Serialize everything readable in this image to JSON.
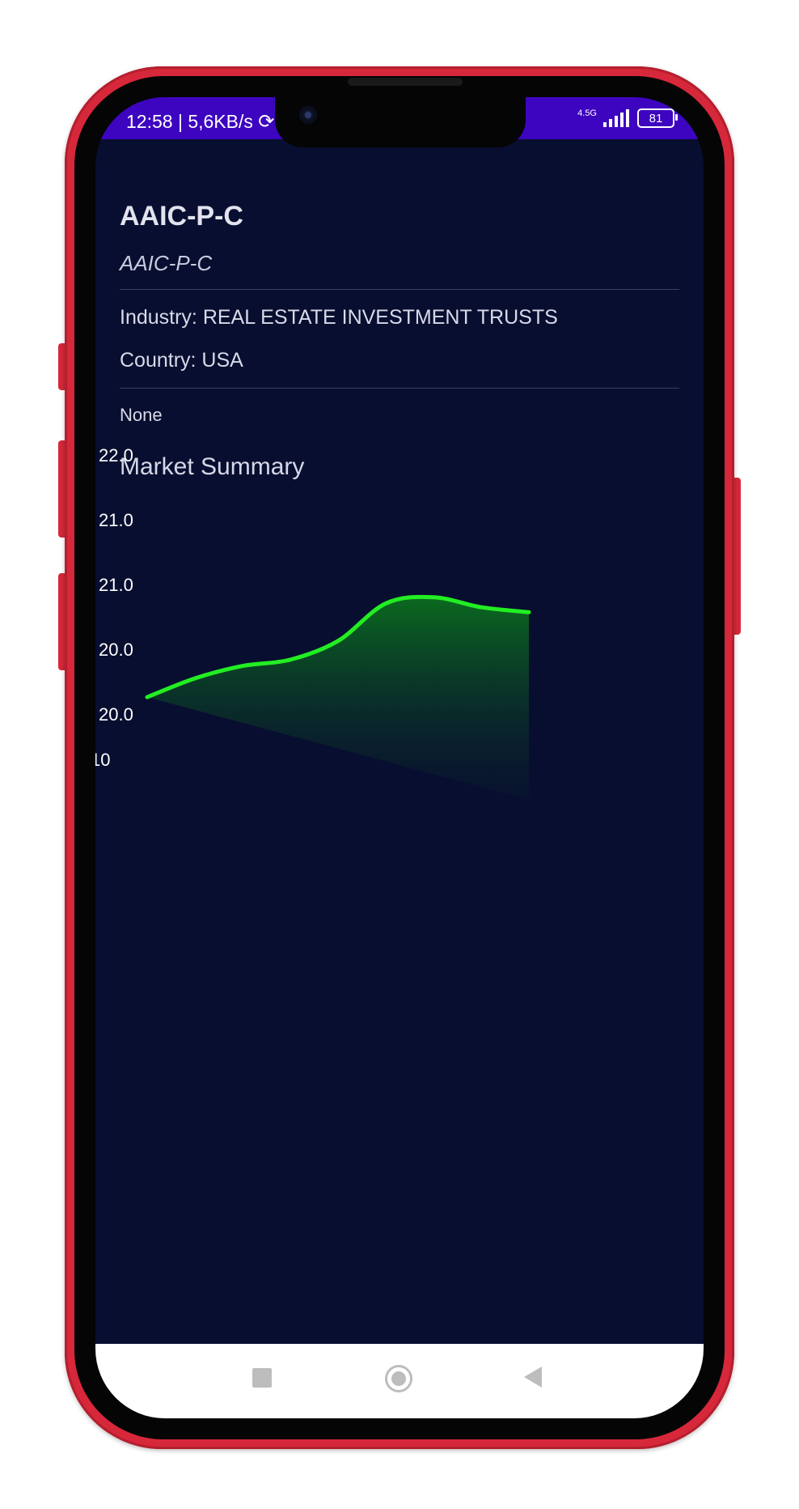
{
  "status_bar": {
    "time": "12:58",
    "speed": "5,6KB/s",
    "network": "4.5G",
    "battery": "81"
  },
  "header": {
    "title": "AAIC-P-C",
    "subtitle": "AAIC-P-C"
  },
  "details": {
    "industry": "Industry: REAL ESTATE INVESTMENT TRUSTS",
    "country": "Country: USA",
    "description": "None"
  },
  "section_title": "Market Summary",
  "chart_data": {
    "type": "area",
    "line_color": "#22ee22",
    "fill_color": "#0b5a1f",
    "y_tick_labels": [
      "22.0",
      "21.0",
      "21.0",
      "20.0",
      "20.0"
    ],
    "x_tick_labels": [
      "10"
    ],
    "series": [
      {
        "values": [
          20.8,
          20.95,
          21.05,
          21.1,
          21.25,
          21.55,
          21.6,
          21.52,
          21.48
        ]
      }
    ],
    "ylim": [
      19.9,
      22.0
    ],
    "grid": false
  },
  "colors": {
    "screen_bg": "#080e2f",
    "status_bar_bg": "#3d05c0",
    "frame": "#d6283a"
  }
}
